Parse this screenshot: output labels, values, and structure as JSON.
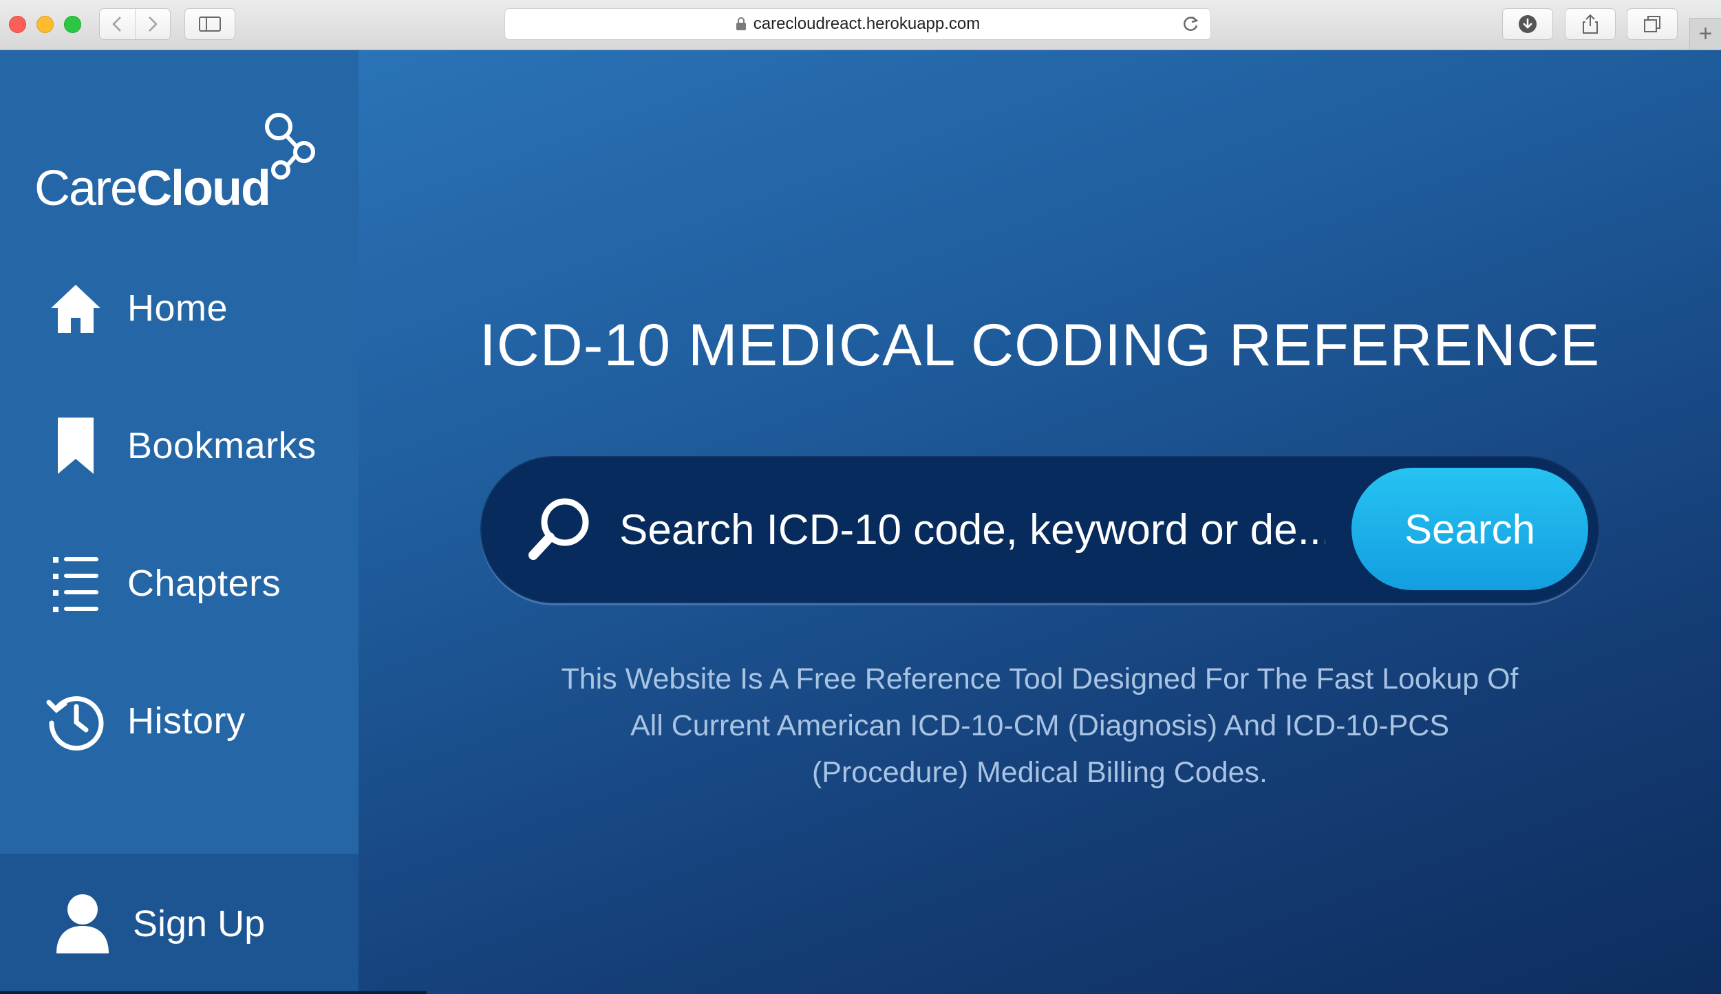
{
  "browser": {
    "url": "carecloudreact.herokuapp.com",
    "new_tab_label": "+"
  },
  "sidebar": {
    "logo": {
      "text_light": "Care",
      "text_bold": "Cloud"
    },
    "items": [
      {
        "label": "Home",
        "icon": "home-icon"
      },
      {
        "label": "Bookmarks",
        "icon": "bookmark-icon"
      },
      {
        "label": "Chapters",
        "icon": "list-icon"
      },
      {
        "label": "History",
        "icon": "history-icon"
      }
    ],
    "signup": {
      "label": "Sign Up",
      "icon": "user-icon"
    }
  },
  "main": {
    "headline": "ICD-10 MEDICAL CODING REFERENCE",
    "search": {
      "placeholder": "Search ICD-10 code, keyword or de...",
      "button_label": "Search"
    },
    "description": "This Website Is A Free Reference Tool Designed For The Fast Lookup Of All Current American ICD-10-CM (Diagnosis) And ICD-10-PCS (Procedure) Medical Billing Codes."
  },
  "colors": {
    "sidebar": "#2466a6",
    "signup_bg": "#1c5592",
    "search_bg": "#062b5c",
    "search_button": "#1eb2ea",
    "description_text": "#a9c3e2"
  }
}
